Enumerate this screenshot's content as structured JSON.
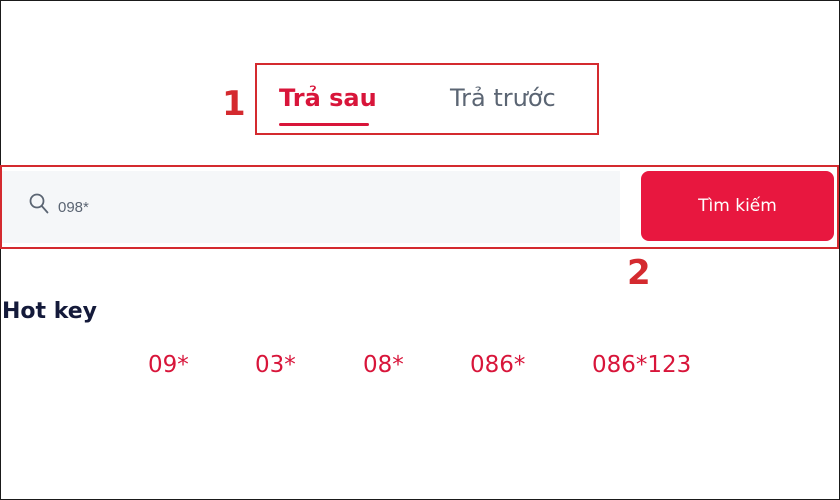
{
  "tabs": {
    "active_label": "Trả sau",
    "inactive_label": "Trả trước"
  },
  "annotations": {
    "first": "1",
    "second": "2"
  },
  "search": {
    "value": "098*",
    "button_label": "Tìm kiếm"
  },
  "hotkeys": {
    "title": "Hot key",
    "items": [
      "09*",
      "03*",
      "08*",
      "086*",
      "086*123"
    ]
  },
  "colors": {
    "accent": "#e8173f",
    "accent_text": "#d8153a",
    "annotation": "#d42a2f",
    "inactive_tab": "#5b6573",
    "title_text": "#141a3a",
    "search_bg": "#f5f7f9"
  }
}
